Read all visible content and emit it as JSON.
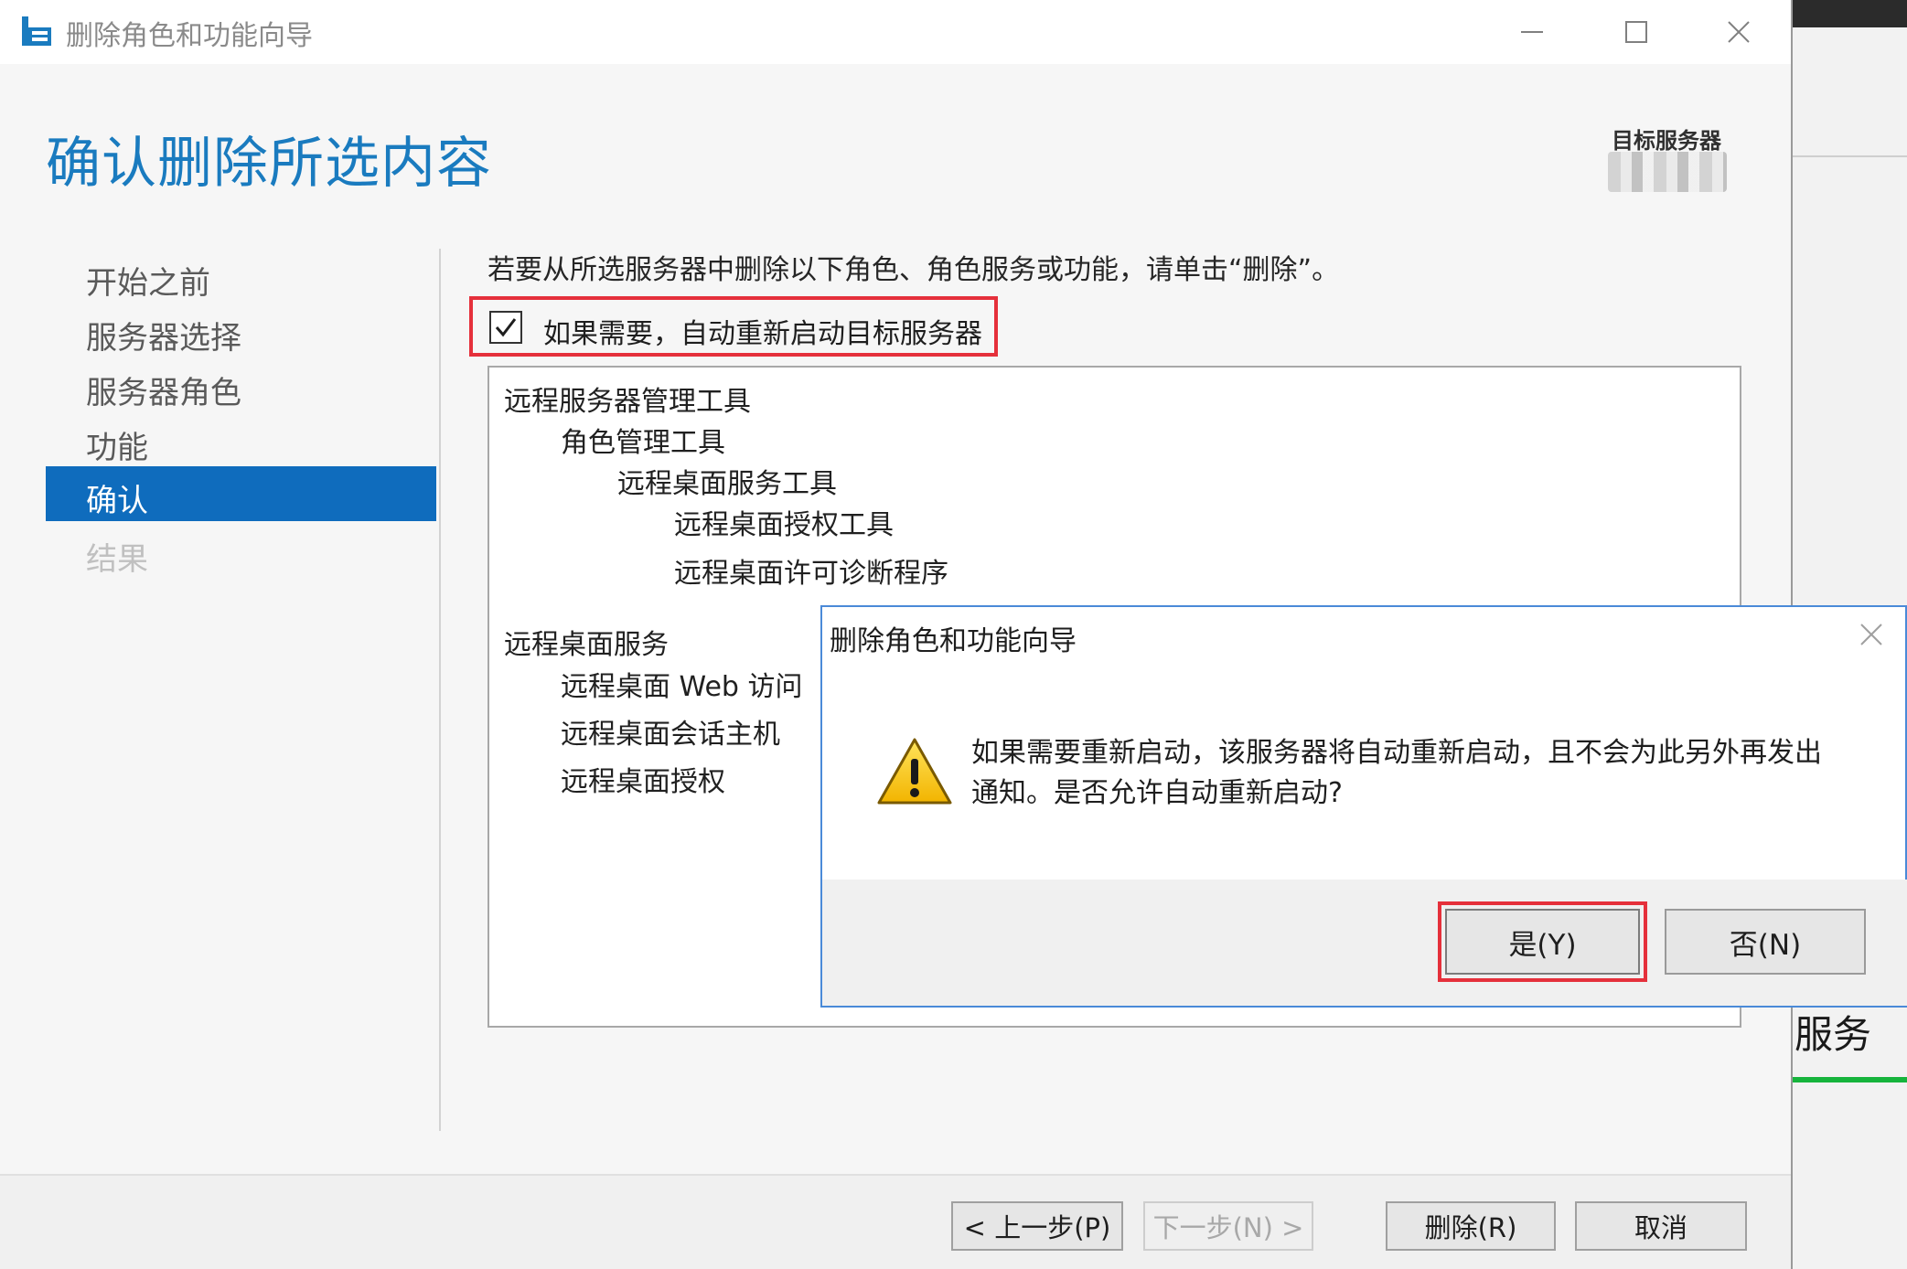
{
  "background": {
    "partial_text": "服务"
  },
  "window": {
    "title": "删除角色和功能向导",
    "controls": [
      "minimize-icon",
      "maximize-icon",
      "close-icon"
    ]
  },
  "page": {
    "heading": "确认删除所选内容",
    "target_server_label": "目标服务器"
  },
  "nav": {
    "items": [
      {
        "label": "开始之前",
        "state": "normal"
      },
      {
        "label": "服务器选择",
        "state": "normal"
      },
      {
        "label": "服务器角色",
        "state": "normal"
      },
      {
        "label": "功能",
        "state": "normal"
      },
      {
        "label": "确认",
        "state": "active"
      },
      {
        "label": "结果",
        "state": "disabled"
      }
    ]
  },
  "main": {
    "instruction": "若要从所选服务器中删除以下角色、角色服务或功能，请单击“删除”。",
    "restart_checkbox": {
      "label": "如果需要，自动重新启动目标服务器",
      "checked": true
    },
    "items": [
      {
        "label": "远程服务器管理工具",
        "level": 0
      },
      {
        "label": "角色管理工具",
        "level": 1
      },
      {
        "label": "远程桌面服务工具",
        "level": 2
      },
      {
        "label": "远程桌面授权工具",
        "level": 3
      },
      {
        "label": "远程桌面许可诊断程序",
        "level": 3
      },
      {
        "label": "远程桌面服务",
        "level": 0
      },
      {
        "label": "远程桌面 Web 访问",
        "level": 1
      },
      {
        "label": "远程桌面会话主机",
        "level": 1
      },
      {
        "label": "远程桌面授权",
        "level": 1
      }
    ]
  },
  "footer": {
    "prev": "< 上一步(P)",
    "next": "下一步(N) >",
    "remove": "删除(R)",
    "cancel": "取消"
  },
  "dialog": {
    "title": "删除角色和功能向导",
    "message_line1": "如果需要重新启动，该服务器将自动重新启动，且不会为此另外再发出",
    "message_line2": "通知。是否允许自动重新启动?",
    "yes": "是(Y)",
    "no": "否(N)",
    "icon": "warning-icon"
  },
  "colors": {
    "heading": "#1a7bbf",
    "nav_active": "#0f6cbd",
    "highlight": "#e5303b",
    "dialog_border": "#4a8ad8"
  }
}
